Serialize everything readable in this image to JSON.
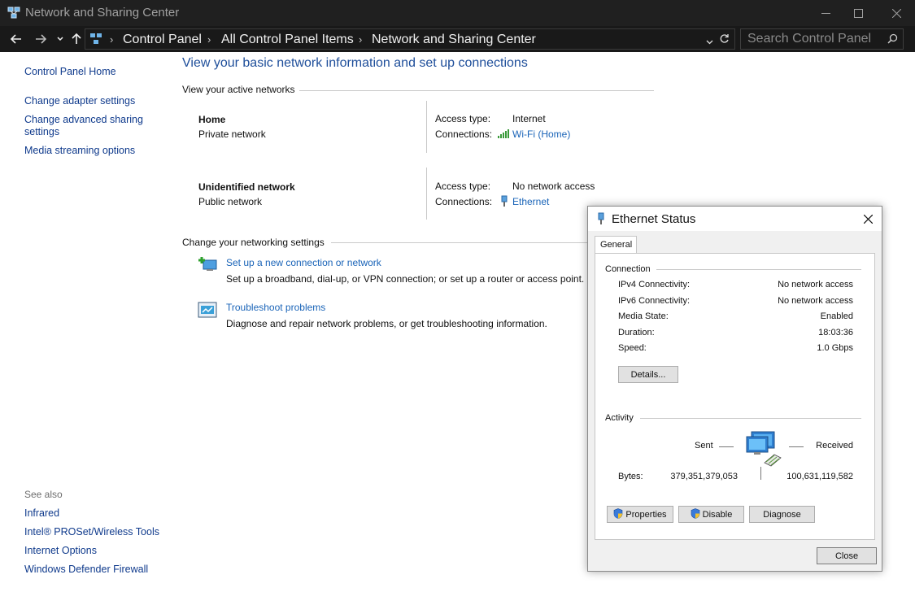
{
  "window": {
    "title": "Network and Sharing Center",
    "controls": {
      "minimize": "—",
      "maximize": "☐",
      "close": "✕"
    }
  },
  "addressbar": {
    "breadcrumbs": [
      "Control Panel",
      "All Control Panel Items",
      "Network and Sharing Center"
    ],
    "search_placeholder": "Search Control Panel"
  },
  "sidebar": {
    "home": "Control Panel Home",
    "links": [
      "Change adapter settings",
      "Change advanced sharing settings",
      "Media streaming options"
    ],
    "see_also_label": "See also",
    "see_also": [
      "Infrared",
      "Intel® PROSet/Wireless Tools",
      "Internet Options",
      "Windows Defender Firewall"
    ]
  },
  "main": {
    "title": "View your basic network information and set up connections",
    "active_networks_heading": "View your active networks",
    "networks": [
      {
        "name": "Home",
        "category": "Private network",
        "access_label": "Access type:",
        "access": "Internet",
        "connections_label": "Connections:",
        "connection": "Wi-Fi (Home)",
        "connection_icon": "wifi-signal-icon"
      },
      {
        "name": "Unidentified network",
        "category": "Public network",
        "access_label": "Access type:",
        "access": "No network access",
        "connections_label": "Connections:",
        "connection": "Ethernet",
        "connection_icon": "ethernet-icon"
      }
    ],
    "change_settings_heading": "Change your networking settings",
    "tasks": [
      {
        "link": "Set up a new connection or network",
        "desc": "Set up a broadband, dial-up, or VPN connection; or set up a router or access point.",
        "icon": "new-connection-icon"
      },
      {
        "link": "Troubleshoot problems",
        "desc": "Diagnose and repair network problems, or get troubleshooting information.",
        "icon": "troubleshoot-icon"
      }
    ]
  },
  "dialog": {
    "title": "Ethernet Status",
    "tab": "General",
    "connection_heading": "Connection",
    "rows": [
      {
        "label": "IPv4 Connectivity:",
        "value": "No network access"
      },
      {
        "label": "IPv6 Connectivity:",
        "value": "No network access"
      },
      {
        "label": "Media State:",
        "value": "Enabled"
      },
      {
        "label": "Duration:",
        "value": "18:03:36"
      },
      {
        "label": "Speed:",
        "value": "1.0 Gbps"
      }
    ],
    "details_button": "Details...",
    "activity_heading": "Activity",
    "sent_label": "Sent",
    "received_label": "Received",
    "bytes_label": "Bytes:",
    "bytes_sent": "379,351,379,053",
    "bytes_received": "100,631,119,582",
    "buttons": {
      "properties": "Properties",
      "disable": "Disable",
      "diagnose": "Diagnose"
    },
    "close_button": "Close"
  },
  "colors": {
    "link": "#1a64b8",
    "title_blue": "#1e4e9a",
    "titlebar": "#202020",
    "addressbar": "#191919"
  }
}
